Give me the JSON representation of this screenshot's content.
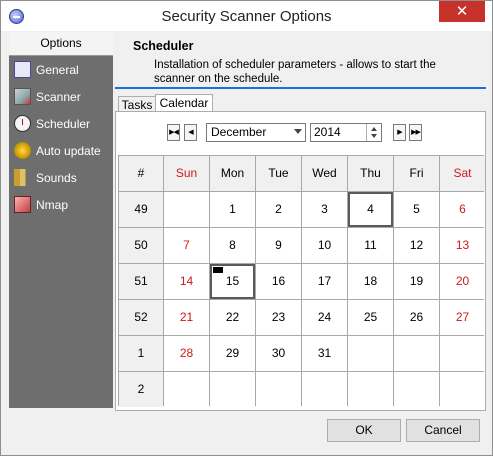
{
  "window": {
    "title": "Security Scanner Options",
    "close_glyph": "✕"
  },
  "sidebar": {
    "header": "Options",
    "items": [
      {
        "label": "General",
        "icon": "general-icon"
      },
      {
        "label": "Scanner",
        "icon": "scanner-icon"
      },
      {
        "label": "Scheduler",
        "icon": "scheduler-icon"
      },
      {
        "label": "Auto update",
        "icon": "auto-update-icon"
      },
      {
        "label": "Sounds",
        "icon": "sounds-icon"
      },
      {
        "label": "Nmap",
        "icon": "nmap-icon"
      }
    ]
  },
  "section": {
    "title": "Scheduler",
    "description": "Installation of scheduler parameters - allows to start the scanner on the schedule."
  },
  "tabs": [
    {
      "label": "Tasks"
    },
    {
      "label": "Calendar",
      "active": true
    }
  ],
  "calendar": {
    "nav": {
      "first": "▶◀",
      "prev": "◀",
      "next": "▶",
      "last": "▶▶"
    },
    "month": "December",
    "year": "2014",
    "header": [
      "#",
      "Sun",
      "Mon",
      "Tue",
      "Wed",
      "Thu",
      "Fri",
      "Sat"
    ],
    "weeks": [
      {
        "wk": "49",
        "days": [
          "",
          "1",
          "2",
          "3",
          "4",
          "5",
          "6"
        ]
      },
      {
        "wk": "50",
        "days": [
          "7",
          "8",
          "9",
          "10",
          "11",
          "12",
          "13"
        ]
      },
      {
        "wk": "51",
        "days": [
          "14",
          "15",
          "16",
          "17",
          "18",
          "19",
          "20"
        ]
      },
      {
        "wk": "52",
        "days": [
          "21",
          "22",
          "23",
          "24",
          "25",
          "26",
          "27"
        ]
      },
      {
        "wk": "1",
        "days": [
          "28",
          "29",
          "30",
          "31",
          "",
          "",
          ""
        ]
      },
      {
        "wk": "2",
        "days": [
          "",
          "",
          "",
          "",
          "",
          "",
          ""
        ]
      }
    ],
    "today": "4",
    "selected": "15",
    "weekend_color": "#d01818"
  },
  "buttons": {
    "ok": "OK",
    "cancel": "Cancel"
  }
}
